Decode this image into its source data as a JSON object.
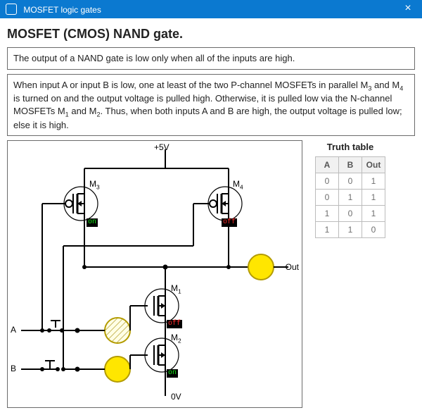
{
  "window": {
    "title": "MOSFET logic gates"
  },
  "page": {
    "heading": "MOSFET (CMOS) NAND gate.",
    "summary": "The output of a NAND gate is low only when all of the inputs are high.",
    "explainer_html": "When input A or input B is low, one at least of the two P-channel MOSFETs in parallel M<sub>3</sub> and M<sub>4</sub> is turned on and the output voltage is pulled high. Otherwise, it is pulled low via the N-channel MOSFETs M<sub>1</sub> and M<sub>2</sub>. Thus, when both inputs A and B are high, the output voltage is pulled low; else it is high."
  },
  "diagram": {
    "rails": {
      "top": "+5V",
      "bottom": "0V"
    },
    "inputs": {
      "A": "A",
      "B": "B"
    },
    "output_label": "Out",
    "transistors": {
      "M1": {
        "label_html": "M<sub>1</sub>",
        "type": "N",
        "state": "off"
      },
      "M2": {
        "label_html": "M<sub>2</sub>",
        "type": "N",
        "state": "on"
      },
      "M3": {
        "label_html": "M<sub>3</sub>",
        "type": "P",
        "state": "on"
      },
      "M4": {
        "label_html": "M<sub>4</sub>",
        "type": "P",
        "state": "off"
      }
    },
    "inputs_state": {
      "A": 0,
      "B": 1
    },
    "output_state": 1
  },
  "truth_table": {
    "title": "Truth table",
    "columns": [
      "A",
      "B",
      "Out"
    ],
    "rows": [
      [
        0,
        0,
        1
      ],
      [
        0,
        1,
        1
      ],
      [
        1,
        0,
        1
      ],
      [
        1,
        1,
        0
      ]
    ]
  }
}
